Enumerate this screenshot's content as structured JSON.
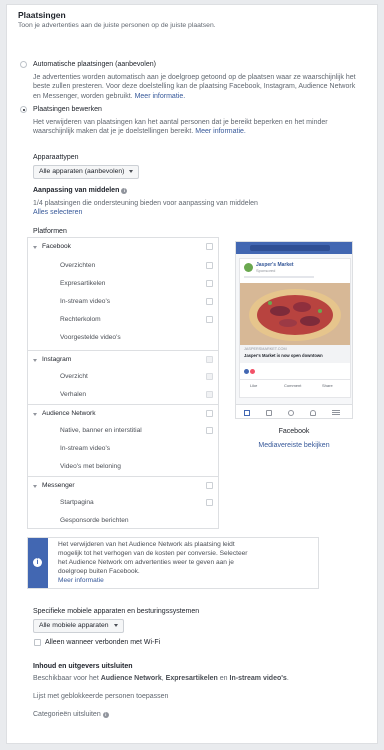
{
  "header": {
    "title": "Plaatsingen",
    "subtitle": "Toon je advertenties aan de juiste personen op de juiste plaatsen."
  },
  "auto": {
    "label": "Automatische plaatsingen (aanbevolen)",
    "desc1": "Je advertenties worden automatisch aan je doelgroep getoond op de plaatsen waar ze waarschijnlijk het",
    "desc2": "beste zullen presteren. Voor deze doelstelling kan de plaatsing Facebook, Instagram, Audience Network",
    "desc3": "en Messenger, worden gebruikt.",
    "more": "Meer informatie."
  },
  "edit": {
    "label": "Plaatsingen bewerken",
    "desc1": "Het verwijderen van plaatsingen kan het aantal personen dat je bereikt beperken en het minder",
    "desc2": "waarschijnlijk maken dat je je doelstellingen bereikt.",
    "more": "Meer informatie."
  },
  "devices": {
    "label": "Apparaattypen",
    "value": "Alle apparaten (aanbevolen)"
  },
  "assets": {
    "label": "Aanpassing van middelen",
    "desc": "1/4 plaatsingen die ondersteuning bieden voor aanpassing van middelen",
    "select_all": "Alles selecteren"
  },
  "platforms": {
    "label": "Platformen",
    "groups": [
      {
        "name": "Facebook",
        "items": [
          "Overzichten",
          "Expresartikelen",
          "In-stream video's",
          "Rechterkolom",
          "Voorgestelde video's"
        ]
      },
      {
        "name": "Instagram",
        "items": [
          "Overzicht",
          "Verhalen"
        ]
      },
      {
        "name": "Audience Network",
        "items": [
          "Native, banner en interstitial",
          "In-stream video's",
          "Video's met beloning"
        ]
      },
      {
        "name": "Messenger",
        "items": [
          "Startpagina",
          "Gesponsorde berichten"
        ]
      }
    ]
  },
  "preview": {
    "page_name": "Jasper's Market",
    "sponsored": "Sponsored",
    "cta_site": "JASPERSMARKET.COM",
    "cta_title": "Jasper's Market is now open downtown",
    "likes": "",
    "actions": [
      "Like",
      "Comment",
      "Share"
    ],
    "caption": "Facebook",
    "media_link": "Mediavereiste bekijken"
  },
  "notice": {
    "line1": "Het verwijderen van het Audience Network als plaatsing leidt",
    "line2": "mogelijk tot het verhogen van de kosten per conversie. Selecteer",
    "line3": "het Audience Network om advertenties weer te geven aan je",
    "line4": "doelgroep buiten Facebook.",
    "more": "Meer informatie"
  },
  "mobile": {
    "label": "Specifieke mobiele apparaten en besturingssystemen",
    "value": "Alle mobiele apparaten",
    "wifi": "Alleen wanneer verbonden met Wi-Fi"
  },
  "exclude": {
    "label": "Inhoud en uitgevers uitsluiten",
    "desc_prefix": "Beschikbaar voor het ",
    "desc_a": "Audience Network",
    "desc_sep1": ", ",
    "desc_b": "Expresartikelen",
    "desc_sep2": " en ",
    "desc_c": "In-stream video's",
    "desc_end": ".",
    "block_list": "Lijst met geblokkeerde personen toepassen",
    "categories": "Categorieën uitsluiten"
  }
}
